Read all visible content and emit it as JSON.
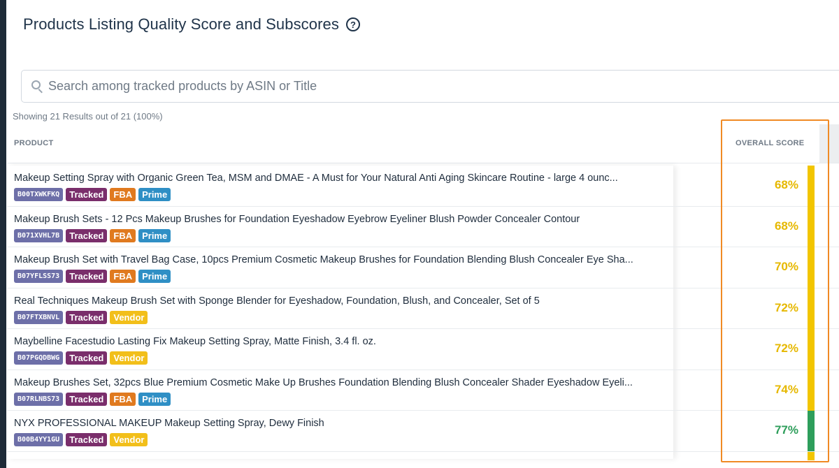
{
  "page": {
    "title": "Products Listing Quality Score and Subscores",
    "help_icon": "?"
  },
  "search": {
    "placeholder": "Search among tracked products by ASIN or Title",
    "value": ""
  },
  "results": {
    "summary": "Showing 21 Results out of 21 (100%)"
  },
  "table": {
    "columns": {
      "product": "PRODUCT",
      "overall_score": "OVERALL SCORE"
    },
    "colors": {
      "score_yellow": "#e6b800",
      "score_green": "#2e9e5b",
      "bar_yellow": "#f2c500",
      "bar_green": "#2e9e5b",
      "highlight": "#f08a24"
    },
    "rows": [
      {
        "title": "Makeup Setting Spray with Organic Green Tea, MSM and DMAE - A Must for Your Natural Anti Aging Skincare Routine - large 4 ounc...",
        "asin": "B00TXWKFKQ",
        "badges": [
          "Tracked",
          "FBA",
          "Prime"
        ],
        "score": "68%",
        "level": "yellow"
      },
      {
        "title": "Makeup Brush Sets - 12 Pcs Makeup Brushes for Foundation Eyeshadow Eyebrow Eyeliner Blush Powder Concealer Contour",
        "asin": "B071XVHL7B",
        "badges": [
          "Tracked",
          "FBA",
          "Prime"
        ],
        "score": "68%",
        "level": "yellow"
      },
      {
        "title": "Makeup Brush Set with Travel Bag Case, 10pcs Premium Cosmetic Makeup Brushes for Foundation Blending Blush Concealer Eye Sha...",
        "asin": "B07YFLSS73",
        "badges": [
          "Tracked",
          "FBA",
          "Prime"
        ],
        "score": "70%",
        "level": "yellow"
      },
      {
        "title": "Real Techniques Makeup Brush Set with Sponge Blender for Eyeshadow, Foundation, Blush, and Concealer, Set of 5",
        "asin": "B07FTXBNVL",
        "badges": [
          "Tracked",
          "Vendor"
        ],
        "score": "72%",
        "level": "yellow"
      },
      {
        "title": "Maybelline Facestudio Lasting Fix Makeup Setting Spray, Matte Finish, 3.4 fl. oz.",
        "asin": "B07PGQDBWG",
        "badges": [
          "Tracked",
          "Vendor"
        ],
        "score": "72%",
        "level": "yellow"
      },
      {
        "title": "Makeup Brushes Set, 32pcs Blue Premium Cosmetic Make Up Brushes Foundation Blending Blush Concealer Shader Eyeshadow Eyeli...",
        "asin": "B07RLNBS73",
        "badges": [
          "Tracked",
          "FBA",
          "Prime"
        ],
        "score": "74%",
        "level": "yellow"
      },
      {
        "title": "NYX PROFESSIONAL MAKEUP Makeup Setting Spray, Dewy Finish",
        "asin": "B00B4YY1GU",
        "badges": [
          "Tracked",
          "Vendor"
        ],
        "score": "77%",
        "level": "green"
      }
    ]
  }
}
